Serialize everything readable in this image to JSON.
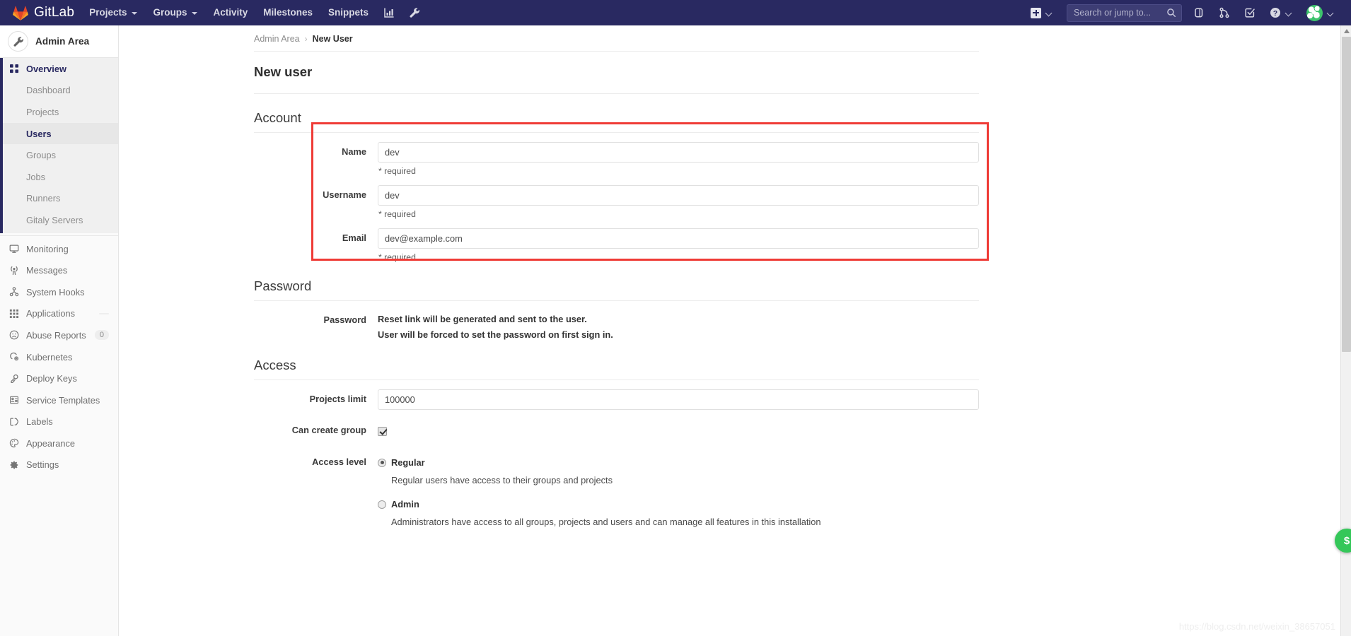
{
  "navbar": {
    "brand": "GitLab",
    "brand_icon": "gitlab-fox-logo",
    "links": [
      {
        "label": "Projects",
        "has_caret": true,
        "name": "nav-projects"
      },
      {
        "label": "Groups",
        "has_caret": true,
        "name": "nav-groups"
      },
      {
        "label": "Activity",
        "has_caret": false,
        "name": "nav-activity"
      },
      {
        "label": "Milestones",
        "has_caret": false,
        "name": "nav-milestones"
      },
      {
        "label": "Snippets",
        "has_caret": false,
        "name": "nav-snippets"
      }
    ],
    "icon_links": [
      "analytics-chart-icon",
      "admin-wrench-icon"
    ],
    "create_new_icon": "plus-square-icon",
    "search": {
      "placeholder": "Search or jump to...",
      "value": "",
      "icon": "search-icon"
    },
    "right_icons": [
      "issues-icon",
      "merge-requests-icon",
      "todos-checkmark-icon",
      "help-question-icon"
    ],
    "avatar_icon": "user-avatar"
  },
  "sidebar": {
    "title": "Admin Area",
    "context_icon": "wrench-icon",
    "overview": {
      "label": "Overview",
      "icon": "overview-grid-icon"
    },
    "sub_items": [
      {
        "label": "Dashboard",
        "selected": false
      },
      {
        "label": "Projects",
        "selected": false
      },
      {
        "label": "Users",
        "selected": true
      },
      {
        "label": "Groups",
        "selected": false
      },
      {
        "label": "Jobs",
        "selected": false
      },
      {
        "label": "Runners",
        "selected": false
      },
      {
        "label": "Gitaly Servers",
        "selected": false
      }
    ],
    "items": [
      {
        "label": "Monitoring",
        "icon": "monitor-icon",
        "badge": ""
      },
      {
        "label": "Messages",
        "icon": "broadcast-icon",
        "badge": ""
      },
      {
        "label": "System Hooks",
        "icon": "hook-icon",
        "badge": ""
      },
      {
        "label": "Applications",
        "icon": "applications-icon",
        "badge": ""
      },
      {
        "label": "Abuse Reports",
        "icon": "frown-face-icon",
        "badge": "0"
      },
      {
        "label": "Kubernetes",
        "icon": "kubernetes-icon",
        "badge": ""
      },
      {
        "label": "Deploy Keys",
        "icon": "key-icon",
        "badge": ""
      },
      {
        "label": "Service Templates",
        "icon": "template-icon",
        "badge": ""
      },
      {
        "label": "Labels",
        "icon": "labels-icon",
        "badge": ""
      },
      {
        "label": "Appearance",
        "icon": "palette-icon",
        "badge": ""
      },
      {
        "label": "Settings",
        "icon": "gear-icon",
        "badge": ""
      }
    ]
  },
  "breadcrumb": {
    "parent": "Admin Area",
    "separator": "›",
    "current": "New User"
  },
  "page": {
    "title": "New user"
  },
  "account": {
    "heading": "Account",
    "name": {
      "label": "Name",
      "value": "dev",
      "help": "* required"
    },
    "username": {
      "label": "Username",
      "value": "dev",
      "help": "* required"
    },
    "email": {
      "label": "Email",
      "value": "dev@example.com",
      "help": "* required"
    }
  },
  "password": {
    "heading": "Password",
    "label": "Password",
    "line1": "Reset link will be generated and sent to the user.",
    "line2": "User will be forced to set the password on first sign in."
  },
  "access": {
    "heading": "Access",
    "projects_limit": {
      "label": "Projects limit",
      "value": "100000"
    },
    "can_create_group": {
      "label": "Can create group",
      "checked": true
    },
    "access_level": {
      "label": "Access level",
      "options": [
        {
          "label": "Regular",
          "selected": true,
          "description": "Regular users have access to their groups and projects"
        },
        {
          "label": "Admin",
          "selected": false,
          "description": "Administrators have access to all groups, projects and users and can manage all features in this installation"
        }
      ]
    }
  },
  "floating_action": {
    "label": "$",
    "color": "#34c759"
  },
  "watermark": {
    "text": "https://blog.csdn.net/weixin_38657051"
  },
  "colors": {
    "navbar_bg": "#292961",
    "sidebar_bg": "#fafafa",
    "accent": "#292961",
    "annotation_red": "#ef3b36",
    "link_gray": "#8c8c8c"
  }
}
